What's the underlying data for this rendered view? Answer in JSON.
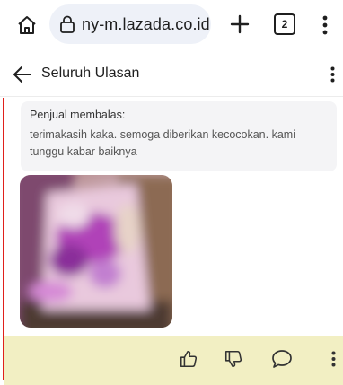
{
  "browser": {
    "url": "ny-m.lazada.co.id",
    "tab_count": "2",
    "icons": {
      "home": "home-icon",
      "lock": "lock-icon",
      "new_tab": "plus-icon",
      "menu": "vertical-dots-icon"
    }
  },
  "page": {
    "title": "Seluruh Ulasan"
  },
  "seller_reply": {
    "label": "Penjual membalas:",
    "text": "terimakasih kaka. semoga diberikan kecocokan. kami tunggu kabar baiknya"
  },
  "colors": {
    "accent": "#e0201b",
    "action_bar": "#f2efc3",
    "reply_bg": "#f4f4f6"
  },
  "actions": {
    "icons": [
      "thumbs-up-icon",
      "thumbs-down-icon",
      "comment-icon",
      "more-icon"
    ]
  }
}
